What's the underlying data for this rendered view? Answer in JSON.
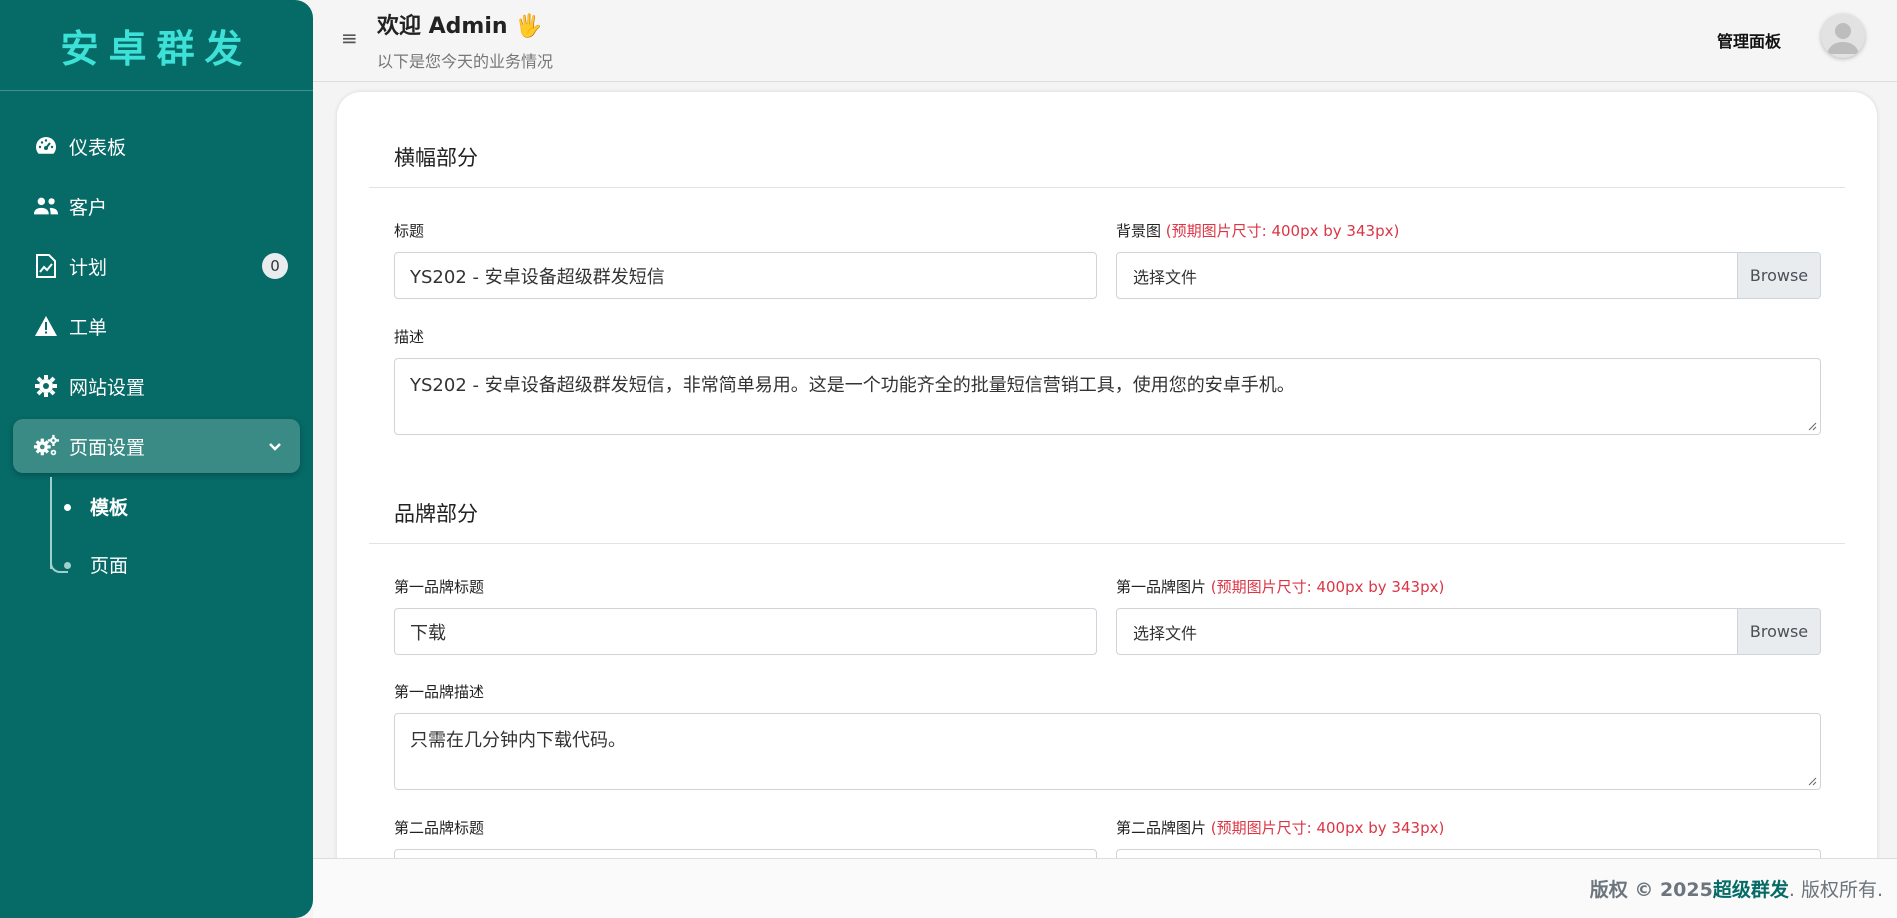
{
  "sidebar": {
    "brand": "安卓群发",
    "items": [
      {
        "label": "仪表板",
        "icon": "speedometer-icon"
      },
      {
        "label": "客户",
        "icon": "users-icon"
      },
      {
        "label": "计划",
        "icon": "chart-doc-icon",
        "badge": "0"
      },
      {
        "label": "工单",
        "icon": "warning-icon"
      },
      {
        "label": "网站设置",
        "icon": "gear-icon"
      },
      {
        "label": "页面设置",
        "icon": "gears-icon",
        "active": true
      }
    ],
    "subitems": [
      {
        "label": "模板",
        "current": true
      },
      {
        "label": "页面"
      }
    ]
  },
  "header": {
    "welcome": "欢迎 Admin 🖐",
    "subtitle": "以下是您今天的业务情况",
    "admin_link": "管理面板"
  },
  "banner": {
    "section_title": "横幅部分",
    "title_label": "标题",
    "title_value": "YS202 - 安卓设备超级群发短信",
    "bg_label": "背景图",
    "bg_hint": "(预期图片尺寸: 400px by 343px)",
    "file_placeholder": "选择文件",
    "browse_label": "Browse",
    "desc_label": "描述",
    "desc_value": "YS202 - 安卓设备超级群发短信，非常简单易用。这是一个功能齐全的批量短信营销工具，使用您的安卓手机。"
  },
  "brands": {
    "section_title": "品牌部分",
    "first_title_label": "第一品牌标题",
    "first_title_value": "下载",
    "first_image_label": "第一品牌图片",
    "image_hint": "(预期图片尺寸: 400px by 343px)",
    "file_placeholder": "选择文件",
    "browse_label": "Browse",
    "first_desc_label": "第一品牌描述",
    "first_desc_value": "只需在几分钟内下载代码。",
    "second_title_label": "第二品牌标题",
    "second_image_label": "第二品牌图片"
  },
  "footer": {
    "prefix": "版权 © 2025 ",
    "brand": "超级群发",
    "suffix": ". 版权所有."
  }
}
